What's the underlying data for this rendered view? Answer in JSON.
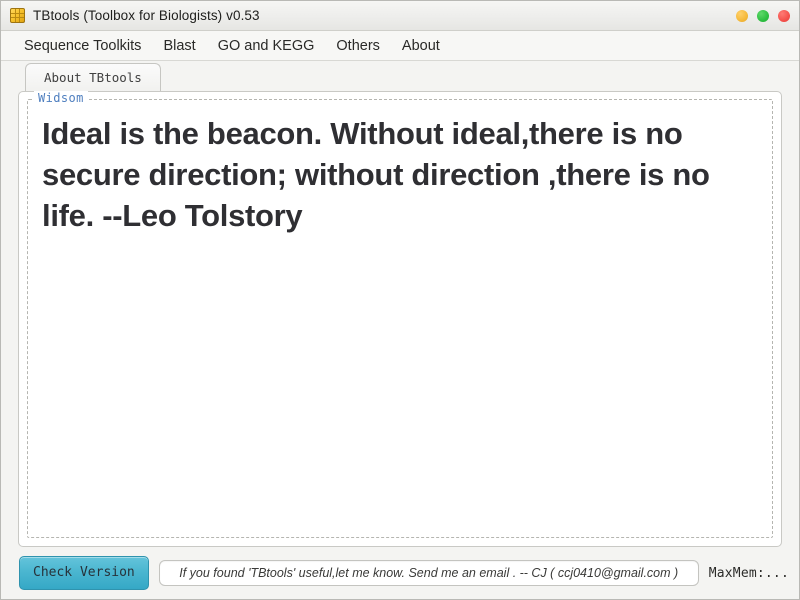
{
  "window": {
    "title": "TBtools (Toolbox for Biologists) v0.53",
    "app_icon": "toolbox-grid-icon",
    "controls": [
      {
        "name": "minimize",
        "label": "",
        "color": "#f5b93a"
      },
      {
        "name": "maximize",
        "label": "",
        "color": "#2fbf42"
      },
      {
        "name": "close",
        "label": "",
        "color": "#f4524c"
      }
    ]
  },
  "menubar": {
    "items": [
      {
        "label": "Sequence Toolkits"
      },
      {
        "label": "Blast"
      },
      {
        "label": "GO and KEGG"
      },
      {
        "label": "Others"
      },
      {
        "label": "About"
      }
    ]
  },
  "tabs": [
    {
      "label": "About TBtools",
      "active": true
    }
  ],
  "panel": {
    "group_label": "Widsom",
    "quote": "Ideal is the beacon. Without ideal,there is no secure direction; without direction ,there is no life. --Leo Tolstory"
  },
  "bottombar": {
    "check_version_label": "Check Version",
    "status_text": "If you found 'TBtools' useful,let me know. Send me an email . -- CJ   ( ccj0410@gmail.com )",
    "maxmem_label": "MaxMem:..."
  },
  "colors": {
    "accent_button": "#4bb6d0",
    "group_label": "#4f7fbf",
    "window_bg": "#f4f4f2",
    "panel_bg": "#ffffff"
  }
}
